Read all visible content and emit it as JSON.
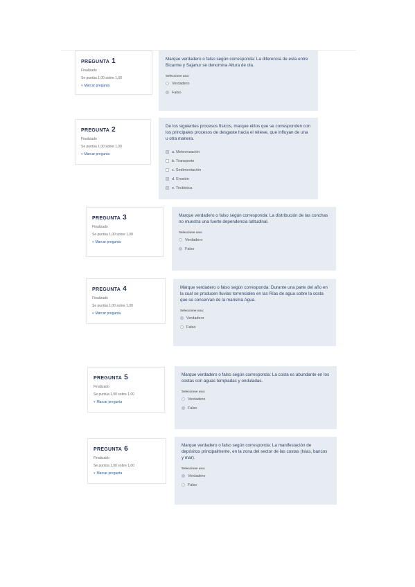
{
  "questions": [
    {
      "label": "PREGUNTA",
      "number": "1",
      "status": "Finalizado",
      "mark": "Se puntúa 1,00 sobre 1,00",
      "flag": "Marcar pregunta",
      "text": "Marque verdadero o falso según corresponda: La diferencia de esta entre Bicarme y Sajanur se denomina Altura de ola.",
      "select_label": "Seleccione una:",
      "options": [
        {
          "text": "Verdadero",
          "selected": false
        },
        {
          "text": "Falso",
          "selected": true
        }
      ],
      "kind": "radio"
    },
    {
      "label": "PREGUNTA",
      "number": "2",
      "status": "Finalizado",
      "mark": "Se puntúa 1,00 sobre 1,00",
      "flag": "Marcar pregunta",
      "text": "De los siguientes procesos físicos, marque el/los que se corresponden con los principales procesos de desgaste hacia el relieve, que influyan de una u otra manera.",
      "select_label": "",
      "options": [
        {
          "text": "a. Meteorización",
          "selected": true
        },
        {
          "text": "b. Transporte",
          "selected": false
        },
        {
          "text": "c. Sedimentación",
          "selected": false
        },
        {
          "text": "d. Erosión",
          "selected": true
        },
        {
          "text": "e. Tectónica",
          "selected": true
        }
      ],
      "kind": "check"
    },
    {
      "label": "PREGUNTA",
      "number": "3",
      "status": "Finalizado",
      "mark": "Se puntúa 1,00 sobre 1,00",
      "flag": "Marcar pregunta",
      "text": "Marque verdadero o falso según corresponda: La distribución de las conchas no muestra una fuerte dependencia latitudinal.",
      "select_label": "Seleccione una:",
      "options": [
        {
          "text": "Verdadero",
          "selected": false
        },
        {
          "text": "Falso",
          "selected": true
        }
      ],
      "kind": "radio"
    },
    {
      "label": "PREGUNTA",
      "number": "4",
      "status": "Finalizado",
      "mark": "Se puntúa 1,00 sobre 1,00",
      "flag": "Marcar pregunta",
      "text": "Marque verdadero o falso según corresponda: Durante una parte del año en la cual se producen lluvias torrenciales en las Rías de agua sobre la costa que se conservan de la marisma Agua.",
      "select_label": "Seleccione una:",
      "options": [
        {
          "text": "Verdadero",
          "selected": true
        },
        {
          "text": "Falso",
          "selected": false
        }
      ],
      "kind": "radio"
    },
    {
      "label": "PREGUNTA",
      "number": "5",
      "status": "Finalizado",
      "mark": "Se puntúa 1,00 sobre 1,00",
      "flag": "Marcar pregunta",
      "text": "Marque verdadero o falso según corresponda: La costa es abundante en los costas con aguas templadas y onduladas.",
      "select_label": "Seleccione una:",
      "options": [
        {
          "text": "Verdadero",
          "selected": false
        },
        {
          "text": "Falso",
          "selected": true
        }
      ],
      "kind": "radio"
    },
    {
      "label": "PREGUNTA",
      "number": "6",
      "status": "Finalizado",
      "mark": "Se puntúa 1,00 sobre 1,00",
      "flag": "Marcar pregunta",
      "text": "Marque verdadero o falso según corresponda: La manifestación de depósitos principalmente, en la zona del sector de las costas (Islas, bancos y mar).",
      "select_label": "Seleccione una:",
      "options": [
        {
          "text": "Verdadero",
          "selected": true
        },
        {
          "text": "Falso",
          "selected": false
        }
      ],
      "kind": "radio"
    }
  ],
  "colors": {
    "panel": "#e7ecf3",
    "text": "#2f4468",
    "link": "#2a5a9a"
  }
}
